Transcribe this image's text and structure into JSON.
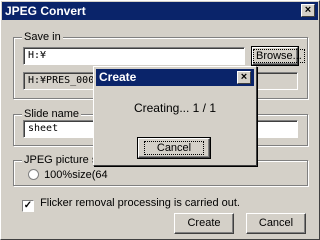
{
  "window": {
    "title": "JPEG Convert",
    "close_glyph": "×"
  },
  "save_in": {
    "legend": "Save in",
    "path_value": "H:¥",
    "browse_label": "Browse...",
    "output_value": "H:¥PRES_000"
  },
  "slide_name": {
    "legend": "Slide name",
    "value": "sheet"
  },
  "jpeg_size": {
    "legend": "JPEG picture size",
    "option_1": "100%size(64"
  },
  "flicker": {
    "checked": true,
    "label": "Flicker removal processing is carried out."
  },
  "buttons": {
    "create": "Create",
    "cancel": "Cancel"
  },
  "create_dialog": {
    "title": "Create",
    "close_glyph": "×",
    "status": "Creating... 1 / 1",
    "cancel_label": "Cancel"
  },
  "icons": [
    "close-icon",
    "checkmark-icon",
    "radio-icon"
  ]
}
